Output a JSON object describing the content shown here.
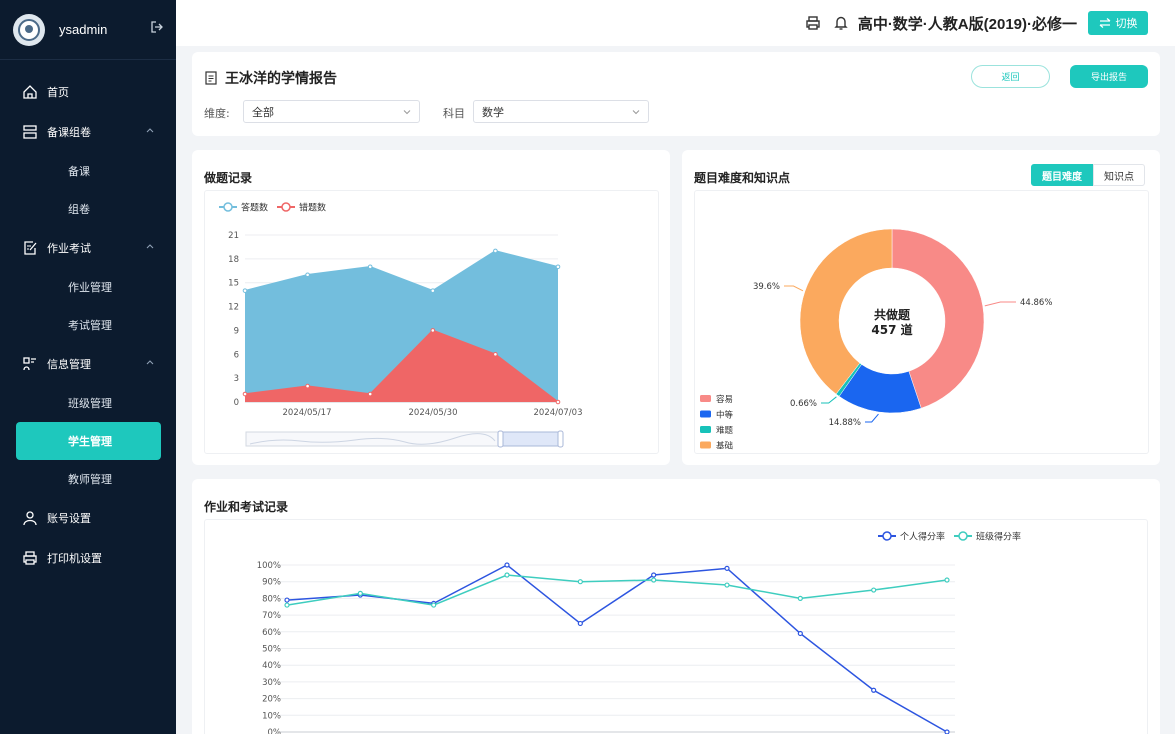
{
  "sidebar": {
    "username": "ysadmin",
    "menu": [
      {
        "label": "首页"
      },
      {
        "label": "备课组卷",
        "children": [
          "备课",
          "组卷"
        ]
      },
      {
        "label": "作业考试",
        "children": [
          "作业管理",
          "考试管理"
        ]
      },
      {
        "label": "信息管理",
        "children": [
          "班级管理",
          "学生管理",
          "教师管理"
        ]
      },
      {
        "label": "账号设置"
      },
      {
        "label": "打印机设置"
      }
    ],
    "active_item": "学生管理"
  },
  "topbar": {
    "course_title": "高中·数学·人教A版(2019)·必修一",
    "switch_label": "切换"
  },
  "report": {
    "title": "王冰洋的学情报告",
    "back_label": "返回",
    "export_label": "导出报告",
    "filters": {
      "dimension_label": "维度:",
      "dimension_value": "全部",
      "subject_label": "科目",
      "subject_value": "数学"
    }
  },
  "practice_card": {
    "title": "做题记录"
  },
  "difficulty_card": {
    "title": "题目难度和知识点",
    "tab_active": "题目难度",
    "tab_other": "知识点",
    "center_line1": "共做题",
    "center_line2": "457 道"
  },
  "homework_card": {
    "title": "作业和考试记录"
  },
  "chart_data": [
    {
      "type": "area",
      "legend": [
        "答题数",
        "错题数"
      ],
      "x_labels": [
        "2024/05/17",
        "2024/05/30",
        "2024/07/03"
      ],
      "ylim": [
        0,
        21
      ],
      "yticks": [
        0,
        3,
        6,
        9,
        12,
        15,
        18,
        21
      ],
      "series": [
        {
          "name": "答题数",
          "color": "#73bedd",
          "values": [
            14,
            16,
            17,
            14,
            19,
            17
          ]
        },
        {
          "name": "错题数",
          "color": "#ef6666",
          "values": [
            1,
            2,
            1,
            9,
            6,
            0
          ]
        }
      ],
      "grid": true,
      "legend_position": "top-left",
      "has_zoom_slider": true
    },
    {
      "type": "pie",
      "donut": true,
      "slices": [
        {
          "name": "容易",
          "value": 44.86,
          "label": "44.86%",
          "color": "#f88a87"
        },
        {
          "name": "中等",
          "value": 14.88,
          "label": "14.88%",
          "color": "#1a66f0"
        },
        {
          "name": "难题",
          "value": 0.66,
          "label": "0.66%",
          "color": "#17c2b9"
        },
        {
          "name": "基础",
          "value": 39.6,
          "label": "39.6%",
          "color": "#fba95e"
        }
      ],
      "legend_position": "bottom-left"
    },
    {
      "type": "line",
      "legend": [
        "个人得分率",
        "班级得分率"
      ],
      "ylim": [
        0,
        100
      ],
      "yticks": [
        "0%",
        "10%",
        "20%",
        "30%",
        "40%",
        "50%",
        "60%",
        "70%",
        "80%",
        "90%",
        "100%"
      ],
      "series": [
        {
          "name": "个人得分率",
          "color": "#2d55e0",
          "values": [
            79,
            82,
            77,
            100,
            65,
            94,
            98,
            59,
            25,
            0
          ]
        },
        {
          "name": "班级得分率",
          "color": "#3ecdbf",
          "values": [
            76,
            83,
            76,
            94,
            90,
            91,
            88,
            80,
            85,
            91
          ]
        }
      ],
      "grid": true,
      "legend_position": "top-right"
    }
  ]
}
